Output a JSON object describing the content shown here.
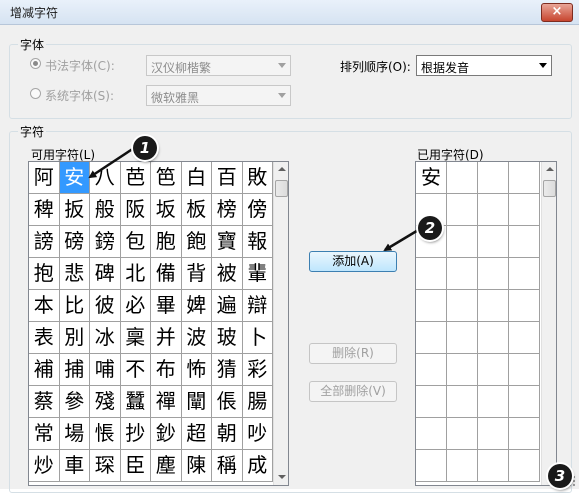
{
  "window": {
    "title": "增减字符",
    "close_icon": "×"
  },
  "font_group": {
    "label": "字体",
    "calligraphy_label": "书法字体(C):",
    "calligraphy_value": "汉仪柳楷繁",
    "system_label": "系统字体(S):",
    "system_value": "微软雅黑",
    "sort_label": "排列顺序(O):",
    "sort_value": "根据发音"
  },
  "chars_group": {
    "label": "字符",
    "available_label": "可用字符(L)",
    "used_label": "已用字符(D)",
    "selected_char": "安",
    "available_rows": [
      [
        "阿",
        "安",
        "八",
        "芭",
        "笆",
        "白",
        "百",
        "敗"
      ],
      [
        "稗",
        "扳",
        "般",
        "阪",
        "坂",
        "板",
        "榜",
        "傍"
      ],
      [
        "謗",
        "磅",
        "鎊",
        "包",
        "胞",
        "飽",
        "寶",
        "報"
      ],
      [
        "抱",
        "悲",
        "碑",
        "北",
        "備",
        "背",
        "被",
        "輩"
      ],
      [
        "本",
        "比",
        "彼",
        "必",
        "畢",
        "婢",
        "遍",
        "辯"
      ],
      [
        "表",
        "別",
        "冰",
        "稟",
        "并",
        "波",
        "玻",
        "卜"
      ],
      [
        "補",
        "捕",
        "哺",
        "不",
        "布",
        "怖",
        "猜",
        "彩"
      ],
      [
        "蔡",
        "參",
        "殘",
        "蠶",
        "禪",
        "闡",
        "倀",
        "腸"
      ],
      [
        "常",
        "場",
        "悵",
        "抄",
        "鈔",
        "超",
        "朝",
        "吵"
      ],
      [
        "炒",
        "車",
        "琛",
        "臣",
        "塵",
        "陳",
        "稱",
        "成"
      ]
    ],
    "used_chars": [
      "安"
    ]
  },
  "buttons": {
    "add": "添加(A)",
    "delete": "删除(R)",
    "delete_all": "全部删除(V)"
  },
  "callouts": [
    "1",
    "2",
    "3"
  ],
  "colors": {
    "selection": "#3399ff",
    "titlebar": "#dbe6f4",
    "close": "#c7452f"
  }
}
